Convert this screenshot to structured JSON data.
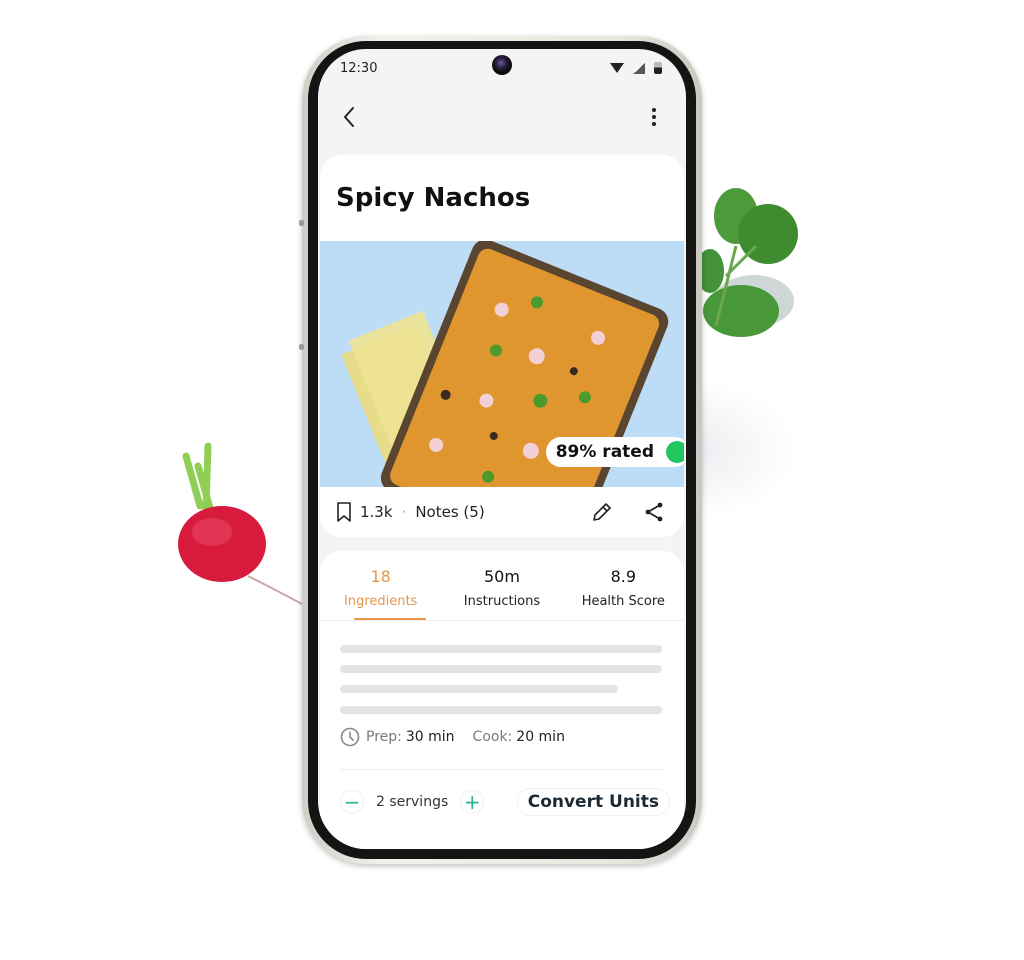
{
  "status_bar": {
    "time": "12:30",
    "icons": [
      "wifi-icon",
      "signal-icon",
      "battery-icon"
    ]
  },
  "app_bar": {
    "back_icon": "chevron-left-icon",
    "more_icon": "more-vertical-icon"
  },
  "recipe": {
    "title": "Spicy Nachos",
    "rating_label": "89% rated",
    "rating_icon": "thumbs-up-icon",
    "save_count": "1.3k",
    "separator": "·",
    "notes_label": "Notes (5)",
    "actions": [
      "bookmark-icon",
      "edit-icon",
      "share-icon"
    ]
  },
  "stats_tabs": [
    {
      "value": "18",
      "label": "Ingredients",
      "active": true
    },
    {
      "value": "50m",
      "label": "Instructions",
      "active": false
    },
    {
      "value": "8.9",
      "label": "Health Score",
      "active": false
    }
  ],
  "times": {
    "prep_label": "Prep:",
    "prep_value": "30 min",
    "cook_label": "Cook:",
    "cook_value": "20 min"
  },
  "servings": {
    "minus": "−",
    "text": "2 servings",
    "plus": "+",
    "convert_label": "Convert Units"
  },
  "colors": {
    "accent": "#e8954a",
    "stepper": "#2bb39a",
    "rating_badge": "#22c55e",
    "hero_bg": "#bddcf6"
  }
}
